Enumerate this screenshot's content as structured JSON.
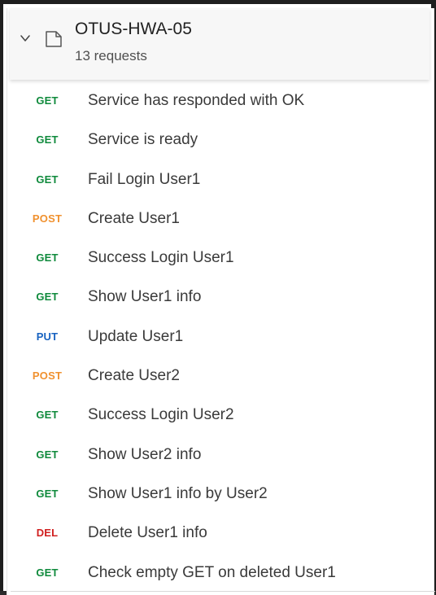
{
  "collection": {
    "title": "OTUS-HWA-05",
    "subtitle": "13 requests",
    "icons": {
      "toggle": "chevron-down-icon",
      "collection": "collection-icon"
    }
  },
  "method_colors": {
    "GET": "#0f8a3c",
    "POST": "#f0912f",
    "PUT": "#1762c0",
    "DEL": "#d01f1f"
  },
  "requests": [
    {
      "method": "GET",
      "name": "Service has responded with OK"
    },
    {
      "method": "GET",
      "name": "Service is ready"
    },
    {
      "method": "GET",
      "name": "Fail Login User1"
    },
    {
      "method": "POST",
      "name": "Create User1"
    },
    {
      "method": "GET",
      "name": "Success Login User1"
    },
    {
      "method": "GET",
      "name": "Show User1 info"
    },
    {
      "method": "PUT",
      "name": "Update User1"
    },
    {
      "method": "POST",
      "name": "Create User2"
    },
    {
      "method": "GET",
      "name": "Success Login User2"
    },
    {
      "method": "GET",
      "name": "Show User2 info"
    },
    {
      "method": "GET",
      "name": "Show User1 info by User2"
    },
    {
      "method": "DEL",
      "name": "Delete User1 info"
    },
    {
      "method": "GET",
      "name": "Check empty GET on deleted User1"
    }
  ]
}
